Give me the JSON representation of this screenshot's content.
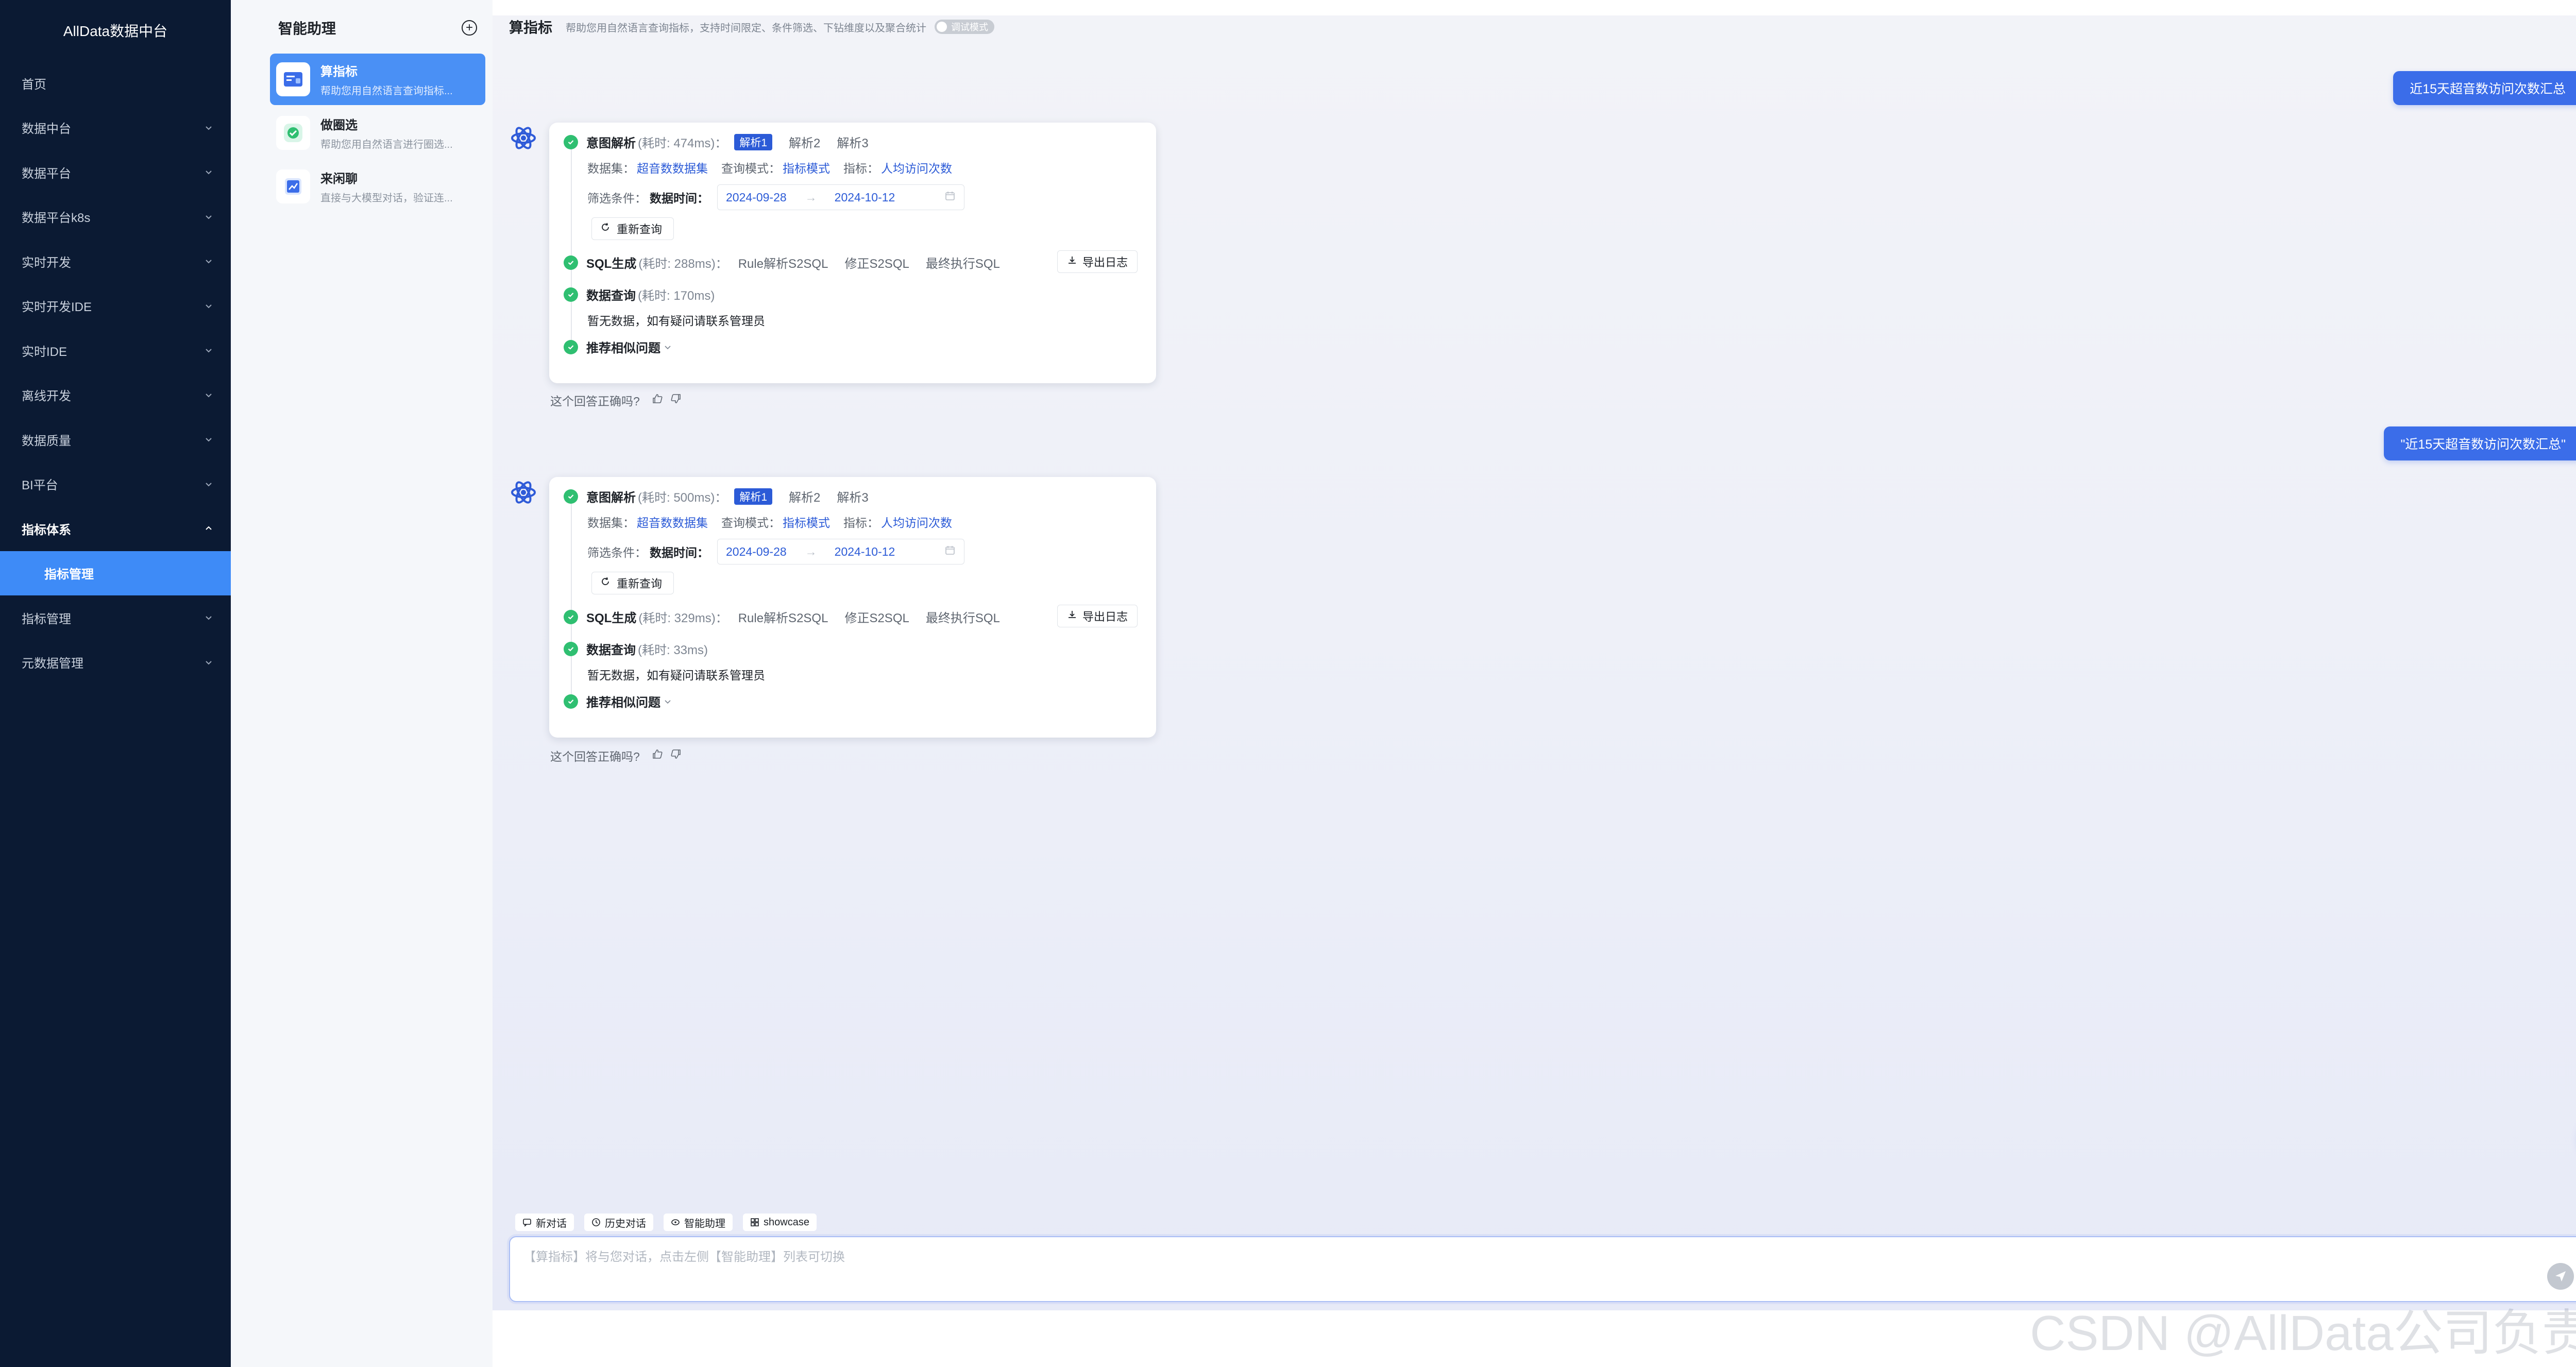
{
  "brand": "AllData数据中台",
  "nav": [
    {
      "label": "首页",
      "expandable": false
    },
    {
      "label": "数据中台",
      "expandable": true
    },
    {
      "label": "数据平台",
      "expandable": true
    },
    {
      "label": "数据平台k8s",
      "expandable": true
    },
    {
      "label": "实时开发",
      "expandable": true
    },
    {
      "label": "实时开发IDE",
      "expandable": true
    },
    {
      "label": "实时IDE",
      "expandable": true
    },
    {
      "label": "离线开发",
      "expandable": true
    },
    {
      "label": "数据质量",
      "expandable": true
    },
    {
      "label": "BI平台",
      "expandable": true
    },
    {
      "label": "指标体系",
      "expandable": true,
      "open": true
    },
    {
      "label": "指标管理",
      "sub": true,
      "active": true
    },
    {
      "label": "指标管理",
      "expandable": true
    },
    {
      "label": "元数据管理",
      "expandable": true
    }
  ],
  "agent_panel": {
    "title": "智能助理",
    "agents": [
      {
        "name": "算指标",
        "desc": "帮助您用自然语言查询指标...",
        "icon": "metric-card-icon",
        "active": true
      },
      {
        "name": "做圈选",
        "desc": "帮助您用自然语言进行圈选...",
        "icon": "selection-check-icon",
        "active": false
      },
      {
        "name": "来闲聊",
        "desc": "直接与大模型对话，验证连...",
        "icon": "chat-chart-icon",
        "active": false
      }
    ]
  },
  "chat": {
    "title": "算指标",
    "description": "帮助您用自然语言查询指标，支持时间限定、条件筛选、下钻维度以及聚合统计",
    "debug_toggle": "调试模式",
    "messages": [
      {
        "question": "近15天超音数访问次数汇总",
        "answer": {
          "intent": {
            "title": "意图解析",
            "cost": "(耗时: 474ms)：",
            "parses": [
              "解析1",
              "解析2",
              "解析3"
            ]
          },
          "dataset_label": "数据集：",
          "dataset": "超音数数据集",
          "mode_label": "查询模式：",
          "mode": "指标模式",
          "metric_label": "指标：",
          "metric": "人均访问次数",
          "filter_label": "筛选条件：",
          "filter_field": "数据时间：",
          "date_start": "2024-09-28",
          "date_end": "2024-10-12",
          "rerun": "重新查询",
          "sql": {
            "title": "SQL生成",
            "cost": "(耗时: 288ms)：",
            "tabs": [
              "Rule解析S2SQL",
              "修正S2SQL",
              "最终执行SQL"
            ],
            "export": "导出日志"
          },
          "query": {
            "title": "数据查询",
            "cost": "(耗时: 170ms)"
          },
          "no_data": "暂无数据，如有疑问请联系管理员",
          "recommend": "推荐相似问题"
        },
        "feedback": "这个回答正确吗?"
      },
      {
        "question": "\"近15天超音数访问次数汇总\"",
        "answer": {
          "intent": {
            "title": "意图解析",
            "cost": "(耗时: 500ms)：",
            "parses": [
              "解析1",
              "解析2",
              "解析3"
            ]
          },
          "dataset_label": "数据集：",
          "dataset": "超音数数据集",
          "mode_label": "查询模式：",
          "mode": "指标模式",
          "metric_label": "指标：",
          "metric": "人均访问次数",
          "filter_label": "筛选条件：",
          "filter_field": "数据时间：",
          "date_start": "2024-09-28",
          "date_end": "2024-10-12",
          "rerun": "重新查询",
          "sql": {
            "title": "SQL生成",
            "cost": "(耗时: 329ms)：",
            "tabs": [
              "Rule解析S2SQL",
              "修正S2SQL",
              "最终执行SQL"
            ],
            "export": "导出日志"
          },
          "query": {
            "title": "数据查询",
            "cost": "(耗时: 33ms)"
          },
          "no_data": "暂无数据，如有疑问请联系管理员",
          "recommend": "推荐相似问题"
        },
        "feedback": "这个回答正确吗?"
      }
    ]
  },
  "quick_tabs": [
    "新对话",
    "历史对话",
    "智能助理",
    "showcase"
  ],
  "input": {
    "placeholder": "【算指标】将与您对话，点击左侧【智能助理】列表可切换",
    "value": ""
  },
  "watermark": "CSDN @AllData公司负责人",
  "colors": {
    "sidebar_bg": "#0b1a33",
    "accent": "#3b6de9",
    "active_nav": "#3e8bf7",
    "success": "#2fbf71"
  }
}
